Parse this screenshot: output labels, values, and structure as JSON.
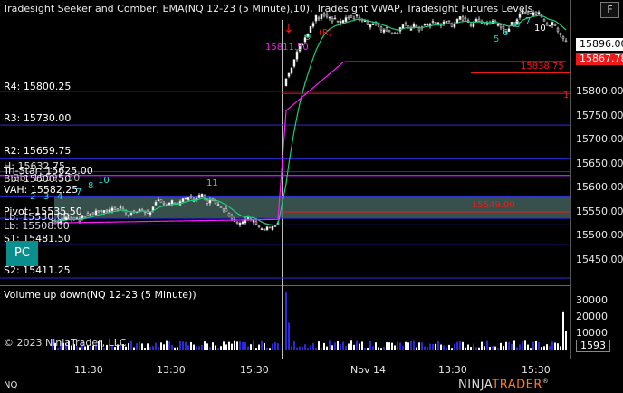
{
  "window": {
    "title": "Tradesight Seeker and Comber, EMA(NQ 12-23 (5 Minute),10), Tradesight VWAP, Tradesight Futures Levels",
    "button_label": "F"
  },
  "levels": [
    {
      "label": "R4: 15800.25",
      "price": 15800.25
    },
    {
      "label": "R3: 15730.00",
      "price": 15730.0
    },
    {
      "label": "R2: 15659.75",
      "price": 15659.75
    },
    {
      "label": "Tri-Star: 15625.00",
      "price": 15625.0
    },
    {
      "label": "VAH: 15582.25",
      "price": 15582.25
    },
    {
      "label": "Pivot: 15535.50",
      "price": 15535.5
    },
    {
      "label": "S1: 15481.50",
      "price": 15481.5
    },
    {
      "label": "S2: 15411.25",
      "price": 15411.25
    }
  ],
  "overlap_labels": [
    "H: 15632.75",
    "Bb: 15600.50",
    "Lb: 15530.00",
    "Lb: 15508.00",
    "Bb: 15595.50"
  ],
  "pc_label": "PC",
  "price_axis": {
    "ticks": [
      {
        "label": "15800.00",
        "value": 15800
      },
      {
        "label": "15750.00",
        "value": 15750
      },
      {
        "label": "15700.00",
        "value": 15700
      },
      {
        "label": "15650.00",
        "value": 15650
      },
      {
        "label": "15600.00",
        "value": 15600
      },
      {
        "label": "15550.00",
        "value": 15550
      },
      {
        "label": "15500.00",
        "value": 15500
      },
      {
        "label": "15450.00",
        "value": 15450
      }
    ],
    "last_price": "15896.00",
    "current_price": "15867.78"
  },
  "annotations": {
    "open_price": "15811.50",
    "r_marker": "(R)",
    "ref_price_1": "15838.75",
    "ref_price_2": "15549.00",
    "level_1": "1",
    "count_11": "11",
    "count_10": "10",
    "count_9": "9",
    "count_8": "8",
    "count_7": "7",
    "count_4": "4",
    "count_3": "3",
    "count_2": "2",
    "count_6": "6",
    "count_5": "5",
    "arrow": "↓"
  },
  "volume": {
    "title": "Volume up down(NQ 12-23 (5 Minute))",
    "ticks": [
      {
        "label": "30000",
        "value": 30000
      },
      {
        "label": "20000",
        "value": 20000
      },
      {
        "label": "10000",
        "value": 10000
      }
    ],
    "current": "1593"
  },
  "time_axis": [
    "11:30",
    "13:30",
    "15:30",
    "Nov 14",
    "13:30",
    "15:30"
  ],
  "symbol": "NQ",
  "copyright": "© 2023 NinjaTrader, LLC",
  "logo": {
    "prefix": "NINJA",
    "suffix": "TRADER",
    "suffix_mark": "®"
  },
  "colors": {
    "background": "#000000",
    "level_line": "#2b2be0",
    "vwap": "#ff1aff",
    "ema": "#1ecc7a",
    "value_area": "#4a6b66",
    "accent_red": "#ee1a1a",
    "accent_teal": "#0b8e8e"
  }
}
